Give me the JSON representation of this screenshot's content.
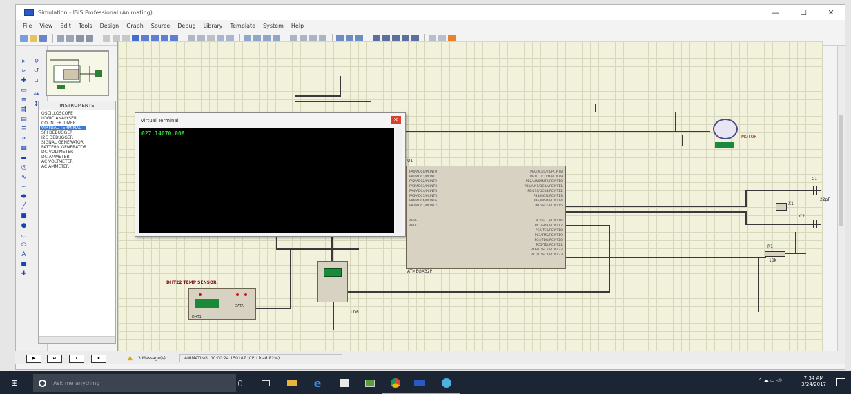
{
  "window": {
    "title": "Simulation - ISIS Professional (Animating)",
    "controls": [
      "—",
      "☐",
      "✕"
    ]
  },
  "menu": [
    "File",
    "View",
    "Edit",
    "Tools",
    "Design",
    "Graph",
    "Source",
    "Debug",
    "Library",
    "Template",
    "System",
    "Help"
  ],
  "instruments": {
    "header": "INSTRUMENTS",
    "items": [
      "OSCILLOSCOPE",
      "LOGIC ANALYSER",
      "COUNTER TIMER",
      "VIRTUAL TERMINAL",
      "SPI DEBUGGER",
      "I2C DEBUGGER",
      "SIGNAL GENERATOR",
      "PATTERN GENERATOR",
      "DC VOLTMETER",
      "DC AMMETER",
      "AC VOLTMETER",
      "AC AMMETER"
    ],
    "selected_index": 3
  },
  "virtual_terminal": {
    "title": "Virtual Terminal",
    "output": "027.14070.008"
  },
  "schematic": {
    "mcu_ref": "U1",
    "mcu_name": "ATMEGA32P",
    "mcu_left_pins": [
      "PA0/ADC0/PCINT0",
      "PA1/ADC1/PCINT1",
      "PA2/ADC2/PCINT2",
      "PA3/ADC3/PCINT3",
      "PA4/ADC4/PCINT4",
      "PA5/ADC5/PCINT5",
      "PA6/ADC6/PCINT6",
      "PA7/ADC7/PCINT7",
      "AREF",
      "AVCC"
    ],
    "mcu_right_pins": [
      "PB0/XCK0/T0/PCINT8",
      "PB1/T1/CLKO/PCINT9",
      "PB2/AIN0/INT2/PCINT10",
      "PB3/AIN1/OC0A/PCINT11",
      "PB4/SS/OC0B/PCINT12",
      "PB5/MOSI/PCINT13",
      "PB6/MISO/PCINT14",
      "PB7/SCK/PCINT15",
      "PC0/SCL/PCINT16",
      "PC1/SDA/PCINT17",
      "PC2/TCK/PCINT18",
      "PC3/TMS/PCINT19",
      "PC4/TDO/PCINT20",
      "PC5/TDI/PCINT21",
      "PC6/TOSC1/PCINT22",
      "PC7/TOSC2/PCINT23"
    ],
    "sensor_label": "DHT22 TEMP SENSOR",
    "sensor_ref": "DHT1",
    "sensor_pin": "DATA",
    "ldr_label": "LDR",
    "motor_label": "MOTOR",
    "crystal_label": "X1",
    "cap1_label": "C1",
    "cap2_label": "C2",
    "res_label": "R1",
    "cap_value": "22pF",
    "res_value": "10k"
  },
  "statusbar": {
    "buttons": [
      "▶",
      "⏯",
      "⏸",
      "⏹"
    ],
    "messages": "3 Message(s)",
    "animating": "ANIMATING: 00:00:24.150187 (CPU load 82%)"
  },
  "taskbar": {
    "search_placeholder": "Ask me anything",
    "time": "7:34 AM",
    "date": "3/24/2017"
  },
  "colors": {
    "canvas": "#f2f2dc",
    "terminal_text": "#3bd13b",
    "component_fill": "#d8d2c2",
    "taskbar": "#1b2533"
  }
}
